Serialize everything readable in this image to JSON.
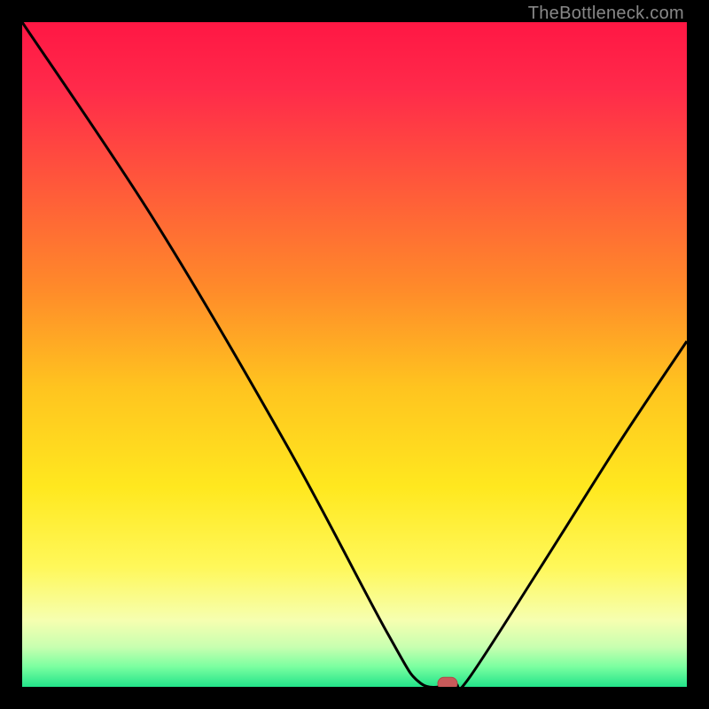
{
  "credit": "TheBottleneck.com",
  "chart_data": {
    "type": "line",
    "title": "",
    "xlabel": "",
    "ylabel": "",
    "xlim": [
      0,
      100
    ],
    "ylim": [
      0,
      100
    ],
    "grid": false,
    "curve": [
      {
        "x": 0,
        "y": 100
      },
      {
        "x": 20,
        "y": 70
      },
      {
        "x": 40,
        "y": 36
      },
      {
        "x": 55,
        "y": 8
      },
      {
        "x": 60,
        "y": 0.5
      },
      {
        "x": 65,
        "y": 0.5
      },
      {
        "x": 67,
        "y": 1
      },
      {
        "x": 78,
        "y": 18
      },
      {
        "x": 90,
        "y": 37
      },
      {
        "x": 100,
        "y": 52
      }
    ],
    "marker": {
      "x": 64,
      "y": 0.5
    },
    "gradient_stops": [
      {
        "pos": 0.0,
        "color": "#ff1744"
      },
      {
        "pos": 0.1,
        "color": "#ff2a4a"
      },
      {
        "pos": 0.25,
        "color": "#ff5a3a"
      },
      {
        "pos": 0.4,
        "color": "#ff8a2a"
      },
      {
        "pos": 0.55,
        "color": "#ffc41f"
      },
      {
        "pos": 0.7,
        "color": "#ffe81f"
      },
      {
        "pos": 0.82,
        "color": "#fff85a"
      },
      {
        "pos": 0.9,
        "color": "#f6ffb0"
      },
      {
        "pos": 0.94,
        "color": "#c8ffb0"
      },
      {
        "pos": 0.97,
        "color": "#7affa0"
      },
      {
        "pos": 1.0,
        "color": "#22e38a"
      }
    ]
  }
}
